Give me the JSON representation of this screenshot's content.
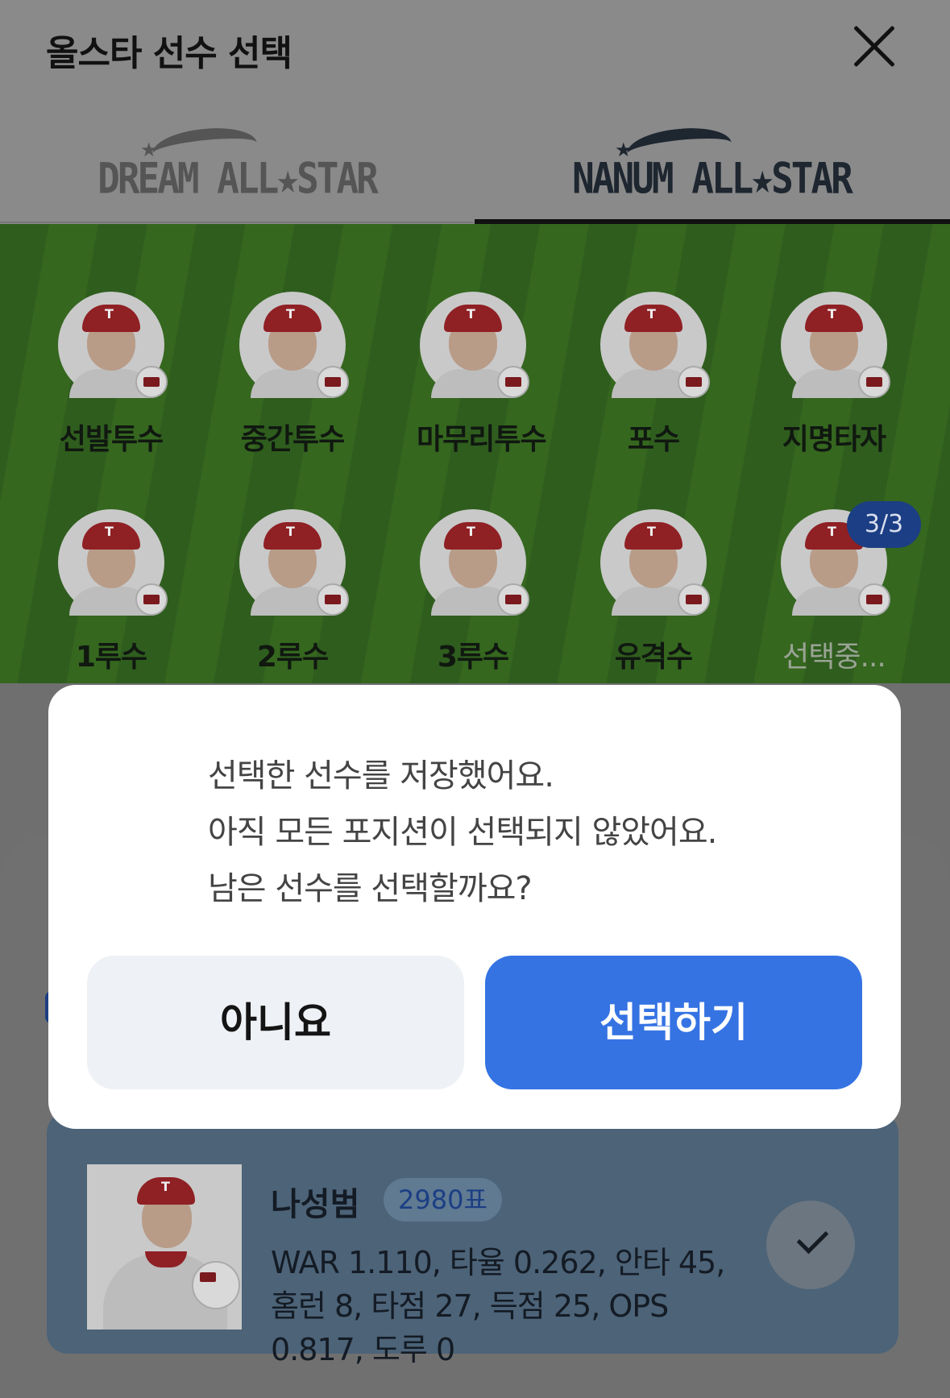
{
  "header": {
    "title": "올스타 선수 선택"
  },
  "tabs": [
    {
      "label": "DREAM ALL★STAR",
      "active": false
    },
    {
      "label": "NANUM ALL★STAR",
      "active": true
    }
  ],
  "positions": [
    {
      "label": "선발투수"
    },
    {
      "label": "중간투수"
    },
    {
      "label": "마무리투수"
    },
    {
      "label": "포수"
    },
    {
      "label": "지명타자"
    },
    {
      "label": "1루수"
    },
    {
      "label": "2루수"
    },
    {
      "label": "3루수"
    },
    {
      "label": "유격수"
    },
    {
      "label": "선택중..."
    }
  ],
  "selection_count": "3/3",
  "dialog": {
    "lines": [
      "선택한 선수를 저장했어요.",
      "아직 모든 포지션이 선택되지 않았어요.",
      "남은 선수를 선택할까요?"
    ],
    "cancel_label": "아니요",
    "confirm_label": "선택하기"
  },
  "player_card": {
    "name": "나성범",
    "votes": "2980표",
    "stats": "WAR 1.110, 타율 0.262, 안타 45, 홈런 8, 타점 27, 득점 25, OPS 0.817, 도루 0"
  },
  "colors": {
    "accent": "#3573e3",
    "badge": "#1c3e84",
    "field": "#35671f"
  }
}
